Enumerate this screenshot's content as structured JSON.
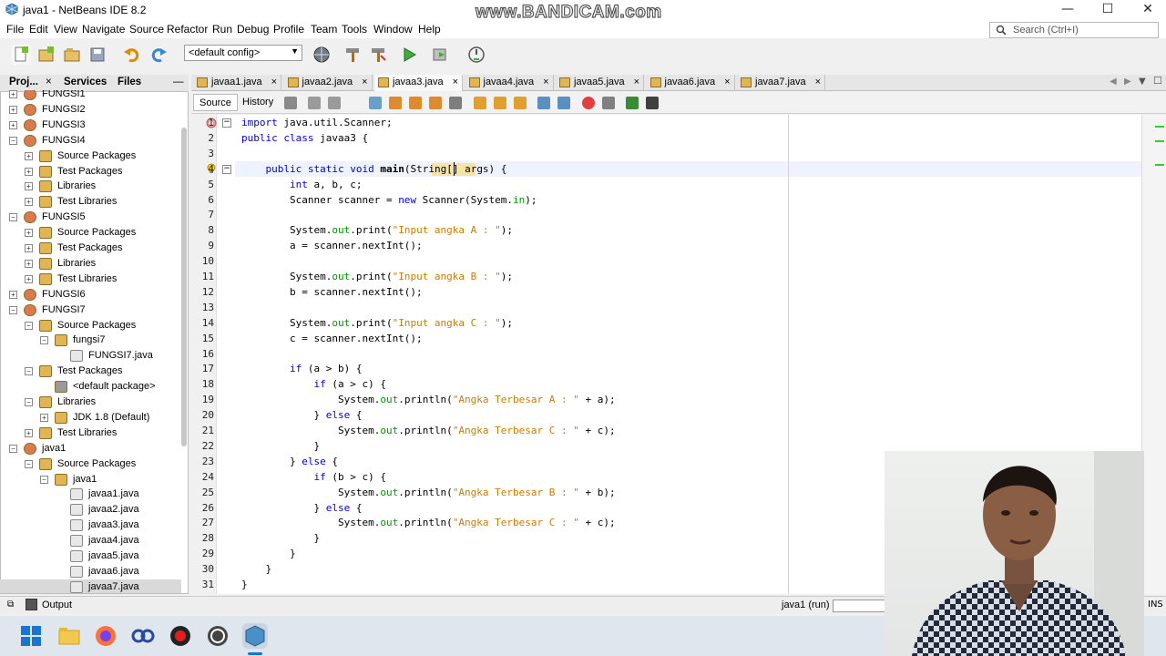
{
  "window": {
    "title": "java1 - NetBeans IDE 8.2",
    "watermark": "www.BANDICAM.com",
    "minimize": "—",
    "maximize": "☐",
    "close": "✕"
  },
  "menu": [
    "File",
    "Edit",
    "View",
    "Navigate",
    "Source",
    "Refactor",
    "Run",
    "Debug",
    "Profile",
    "Team",
    "Tools",
    "Window",
    "Help"
  ],
  "search": {
    "placeholder": "Search (Ctrl+I)"
  },
  "toolbar": {
    "config": "<default config>"
  },
  "panels": {
    "tabs": [
      "Proj...",
      "Services",
      "Files"
    ],
    "close": "×",
    "minimize": "—"
  },
  "tree": [
    {
      "label": "FUNGSI1",
      "type": "project",
      "level": 0,
      "toggle": "+"
    },
    {
      "label": "FUNGSI2",
      "type": "project",
      "level": 0,
      "toggle": "+"
    },
    {
      "label": "FUNGSI3",
      "type": "project",
      "level": 0,
      "toggle": "+"
    },
    {
      "label": "FUNGSI4",
      "type": "project",
      "level": 0,
      "toggle": "−"
    },
    {
      "label": "Source Packages",
      "type": "folder",
      "level": 1,
      "toggle": "+"
    },
    {
      "label": "Test Packages",
      "type": "folder",
      "level": 1,
      "toggle": "+"
    },
    {
      "label": "Libraries",
      "type": "lib",
      "level": 1,
      "toggle": "+"
    },
    {
      "label": "Test Libraries",
      "type": "lib",
      "level": 1,
      "toggle": "+"
    },
    {
      "label": "FUNGSI5",
      "type": "project",
      "level": 0,
      "toggle": "−"
    },
    {
      "label": "Source Packages",
      "type": "folder",
      "level": 1,
      "toggle": "+"
    },
    {
      "label": "Test Packages",
      "type": "folder",
      "level": 1,
      "toggle": "+"
    },
    {
      "label": "Libraries",
      "type": "lib",
      "level": 1,
      "toggle": "+"
    },
    {
      "label": "Test Libraries",
      "type": "lib",
      "level": 1,
      "toggle": "+"
    },
    {
      "label": "FUNGSI6",
      "type": "project",
      "level": 0,
      "toggle": "+"
    },
    {
      "label": "FUNGSI7",
      "type": "project",
      "level": 0,
      "toggle": "−"
    },
    {
      "label": "Source Packages",
      "type": "folder",
      "level": 1,
      "toggle": "−"
    },
    {
      "label": "fungsi7",
      "type": "package",
      "level": 2,
      "toggle": "−"
    },
    {
      "label": "FUNGSI7.java",
      "type": "java",
      "level": 3,
      "toggle": ""
    },
    {
      "label": "Test Packages",
      "type": "folder",
      "level": 1,
      "toggle": "−"
    },
    {
      "label": "<default package>",
      "type": "package-empty",
      "level": 2,
      "toggle": ""
    },
    {
      "label": "Libraries",
      "type": "lib",
      "level": 1,
      "toggle": "−"
    },
    {
      "label": "JDK 1.8 (Default)",
      "type": "lib",
      "level": 2,
      "toggle": "+"
    },
    {
      "label": "Test Libraries",
      "type": "lib",
      "level": 1,
      "toggle": "+"
    },
    {
      "label": "java1",
      "type": "project",
      "level": 0,
      "toggle": "−"
    },
    {
      "label": "Source Packages",
      "type": "folder",
      "level": 1,
      "toggle": "−"
    },
    {
      "label": "java1",
      "type": "package",
      "level": 2,
      "toggle": "−"
    },
    {
      "label": "javaa1.java",
      "type": "java",
      "level": 3,
      "toggle": ""
    },
    {
      "label": "javaa2.java",
      "type": "java",
      "level": 3,
      "toggle": ""
    },
    {
      "label": "javaa3.java",
      "type": "java",
      "level": 3,
      "toggle": ""
    },
    {
      "label": "javaa4.java",
      "type": "java",
      "level": 3,
      "toggle": ""
    },
    {
      "label": "javaa5.java",
      "type": "java",
      "level": 3,
      "toggle": ""
    },
    {
      "label": "javaa6.java",
      "type": "java",
      "level": 3,
      "toggle": ""
    },
    {
      "label": "javaa7.java",
      "type": "java",
      "level": 3,
      "toggle": "",
      "selected": true
    }
  ],
  "editor_tabs": [
    {
      "label": "javaa1.java",
      "close": "×"
    },
    {
      "label": "javaa2.java",
      "close": "×"
    },
    {
      "label": "javaa3.java",
      "close": "×",
      "active": true
    },
    {
      "label": "javaa4.java",
      "close": "×"
    },
    {
      "label": "javaa5.java",
      "close": "×"
    },
    {
      "label": "javaa6.java",
      "close": "×"
    },
    {
      "label": "javaa7.java",
      "close": "×"
    }
  ],
  "editor_view_tabs": {
    "source": "Source",
    "history": "History"
  },
  "code_lines": [
    "<span class=\"kw\">import</span> java.util.Scanner;",
    "<span class=\"kw\">public class</span> javaa3 {",
    "",
    "    <span class=\"kw\">public static void</span> <span class=\"bd\">main</span>(String[] args) {",
    "        <span class=\"kw\">int</span> a, b, c;",
    "        Scanner scanner = <span class=\"kw\">new</span> Scanner(System.<span class=\"fd\">in</span>);",
    "",
    "        System.<span class=\"fd\">out</span>.print(<span class=\"st\">\"Input angka A : \"</span>);",
    "        a = scanner.nextInt();",
    "",
    "        System.<span class=\"fd\">out</span>.print(<span class=\"st\">\"Input angka B : \"</span>);",
    "        b = scanner.nextInt();",
    "",
    "        System.<span class=\"fd\">out</span>.print(<span class=\"st\">\"Input angka C : \"</span>);",
    "        c = scanner.nextInt();",
    "",
    "        <span class=\"kw\">if</span> (a &gt; b) {",
    "            <span class=\"kw\">if</span> (a &gt; c) {",
    "                System.<span class=\"fd\">out</span>.println(<span class=\"st\">\"Angka Terbesar A : \"</span> + a);",
    "            } <span class=\"kw\">else</span> {",
    "                System.<span class=\"fd\">out</span>.println(<span class=\"st\">\"Angka Terbesar C : \"</span> + c);",
    "            }",
    "        } <span class=\"kw\">else</span> {",
    "            <span class=\"kw\">if</span> (b &gt; c) {",
    "                System.<span class=\"fd\">out</span>.println(<span class=\"st\">\"Angka Terbesar B : \"</span> + b);",
    "            } <span class=\"kw\">else</span> {",
    "                System.<span class=\"fd\">out</span>.println(<span class=\"st\">\"Angka Terbesar C : \"</span> + c);",
    "            }",
    "        }",
    "    }",
    "}"
  ],
  "output": {
    "label": "Output",
    "status": "java1 (run)",
    "ins": "INS"
  },
  "colors": {
    "keyword": "#0000e6",
    "string": "#ce7b00",
    "field": "#009900",
    "tab_icon": "#e2b554"
  }
}
